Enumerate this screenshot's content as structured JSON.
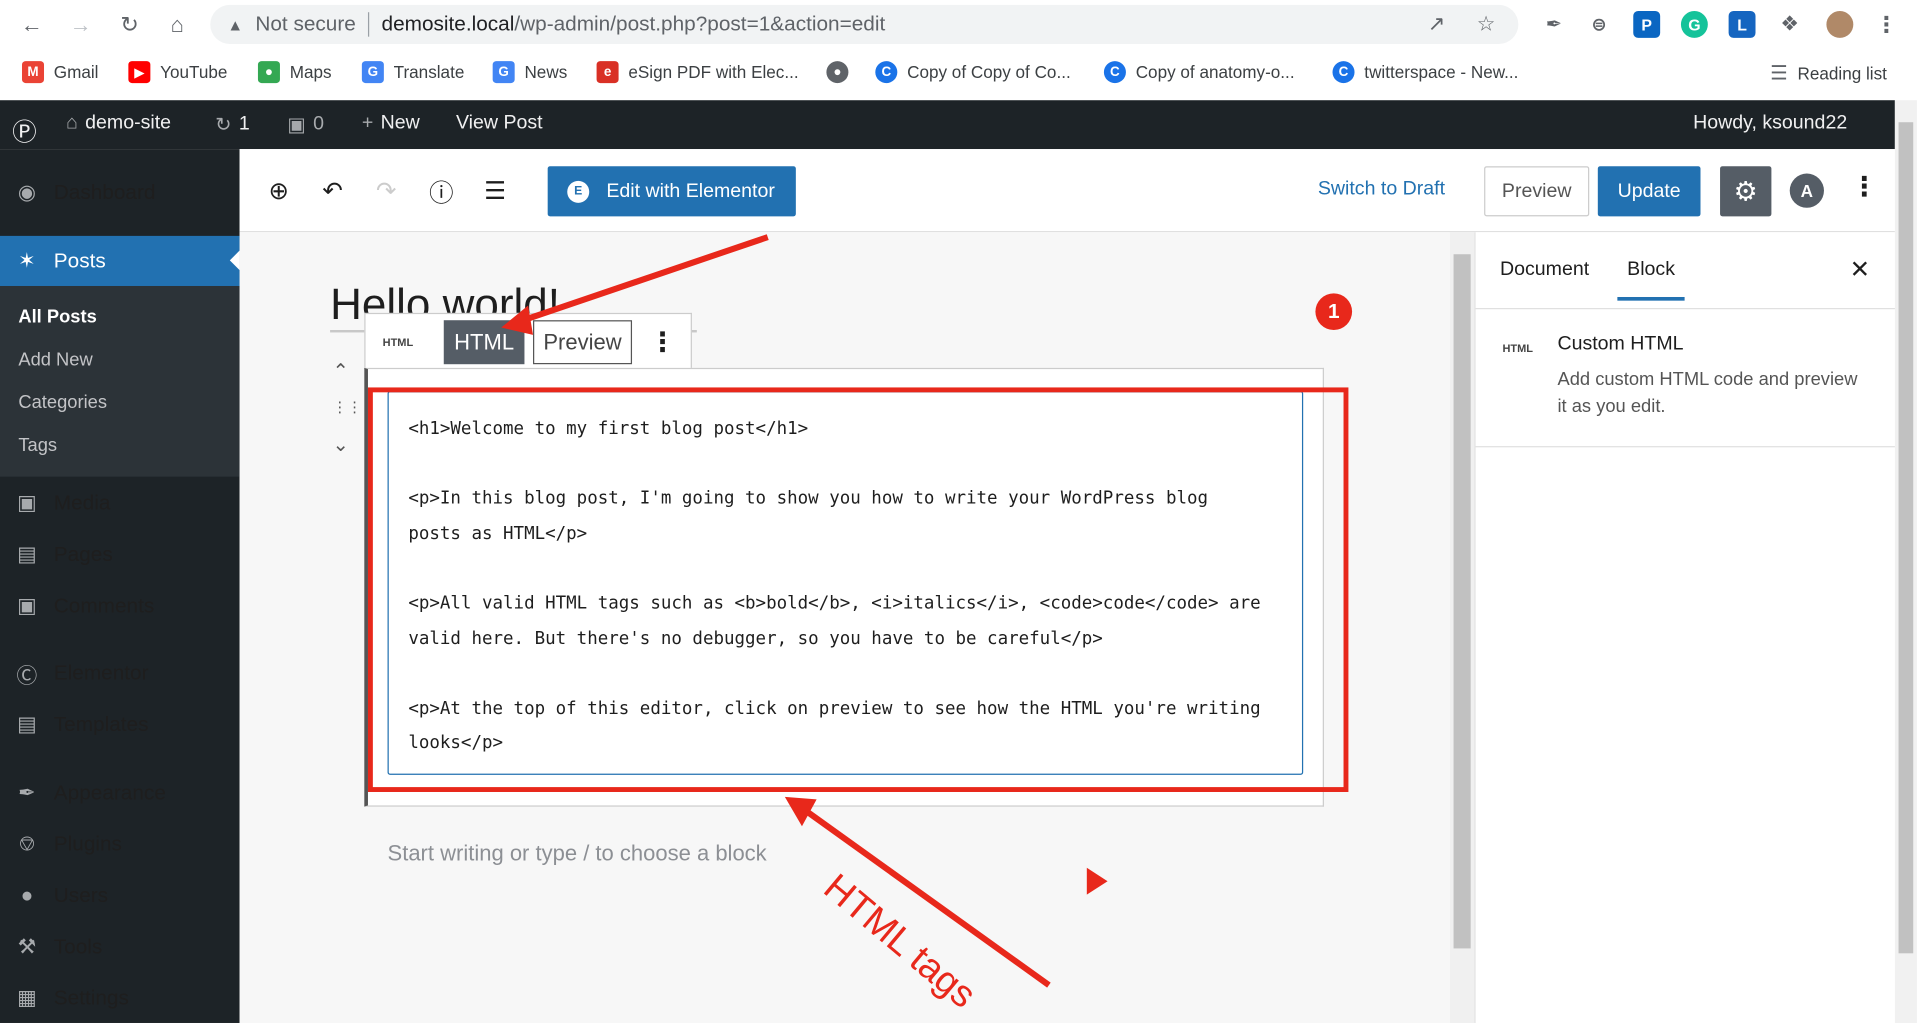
{
  "browser": {
    "security_label": "Not secure",
    "url_domain": "demosite.local",
    "url_path": "/wp-admin/post.php?post=1&action=edit",
    "bookmarks": [
      {
        "label": "Gmail",
        "icon": "gmail-icon",
        "color": "#ea4335"
      },
      {
        "label": "YouTube",
        "icon": "youtube-icon",
        "color": "#ff0000"
      },
      {
        "label": "Maps",
        "icon": "maps-icon",
        "color": "#34a853"
      },
      {
        "label": "Translate",
        "icon": "translate-icon",
        "color": "#4285f4"
      },
      {
        "label": "News",
        "icon": "news-icon",
        "color": "#4285f4"
      },
      {
        "label": "eSign PDF with Elec...",
        "icon": "esign-icon",
        "color": "#d93025"
      },
      {
        "label": "",
        "icon": "globe-icon",
        "color": "#5f6368"
      },
      {
        "label": "Copy of Copy of Co...",
        "icon": "canva-icon",
        "color": "#1a73e8"
      },
      {
        "label": "Copy of anatomy-o...",
        "icon": "canva-icon",
        "color": "#1a73e8"
      },
      {
        "label": "twitterspace - New...",
        "icon": "canva-icon",
        "color": "#1a73e8"
      }
    ],
    "reading_list": "Reading list"
  },
  "adminbar": {
    "site": "demo-site",
    "updates": "1",
    "comments": "0",
    "new": "New",
    "view_post": "View Post",
    "howdy": "Howdy, ksound22"
  },
  "sidebar": {
    "dashboard": "Dashboard",
    "posts": "Posts",
    "sub": [
      "All Posts",
      "Add New",
      "Categories",
      "Tags"
    ],
    "media": "Media",
    "pages": "Pages",
    "comments": "Comments",
    "elementor": "Elementor",
    "templates": "Templates",
    "appearance": "Appearance",
    "plugins": "Plugins",
    "users": "Users",
    "tools": "Tools",
    "settings": "Settings"
  },
  "toolbar": {
    "elementor_label": "Edit with Elementor",
    "switch_to_draft": "Switch to Draft",
    "preview": "Preview",
    "update": "Update"
  },
  "editor": {
    "post_title": "Hello world!",
    "block_toolbar": {
      "icon_label": "HTML",
      "html_tab": "HTML",
      "preview_tab": "Preview"
    },
    "code_lines": [
      "<h1>Welcome to my first blog post</h1>",
      "",
      "<p>In this blog post, I'm going to show you how to write your WordPress blog",
      "posts as HTML</p>",
      "",
      "<p>All valid HTML tags such as <b>bold</b>, <i>italics</i>, <code>code</code> are",
      "valid here. But there's no debugger, so you have to be careful</p>",
      "",
      "<p>At the top of this editor, click on preview to see how the HTML you're writing",
      "looks</p>"
    ],
    "placeholder": "Start writing or type / to choose a block"
  },
  "panel": {
    "tab_document": "Document",
    "tab_block": "Block",
    "block_icon_label": "HTML",
    "block_name": "Custom HTML",
    "block_desc": "Add custom HTML code and preview it as you edit."
  },
  "annotations": {
    "badge": "1",
    "label": "HTML tags",
    "color": "#e8281b"
  },
  "colors": {
    "wp_dark": "#1d2327",
    "wp_blue": "#2271b1"
  }
}
